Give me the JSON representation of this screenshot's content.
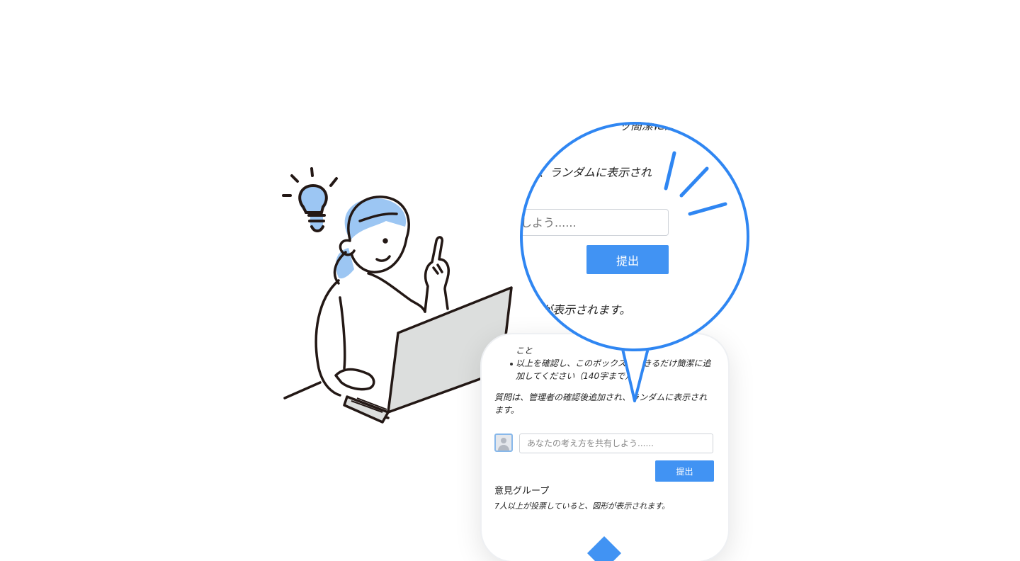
{
  "phone": {
    "fragment_top": "こと",
    "bullet_text": "以上を確認し、このボックスにできるだけ簡潔に追加してください（140字まで）",
    "bullet_line1": "以上を確認し、このボックスにできるだけ簡潔に追",
    "bullet_line2": "加してください（140字まで）",
    "notice_line1": "質問は、管理者の確認後追加され、ランダムに表示され",
    "notice_line2": "ます。",
    "input_placeholder": "あなたの考え方を共有しよう......",
    "submit_label": "提出",
    "group_heading": "意見グループ",
    "group_note": "7人以上が投票していると、図形が表示されます。"
  },
  "zoom": {
    "top_fragment": "ッ簡潔に追",
    "notice_fragment": "、ランダムに表示され",
    "input_placeholder_fragment": "しよう......",
    "submit_label": "提出",
    "note_fragment": "が表示されます。"
  },
  "colors": {
    "accent": "#4193f3",
    "bubble_ring": "#2f86f2",
    "hair": "#9cc6f3",
    "laptop": "#dcdedd",
    "line": "#231815"
  },
  "icons": {
    "avatar": "user-avatar-icon",
    "idea": "lightbulb-icon"
  }
}
